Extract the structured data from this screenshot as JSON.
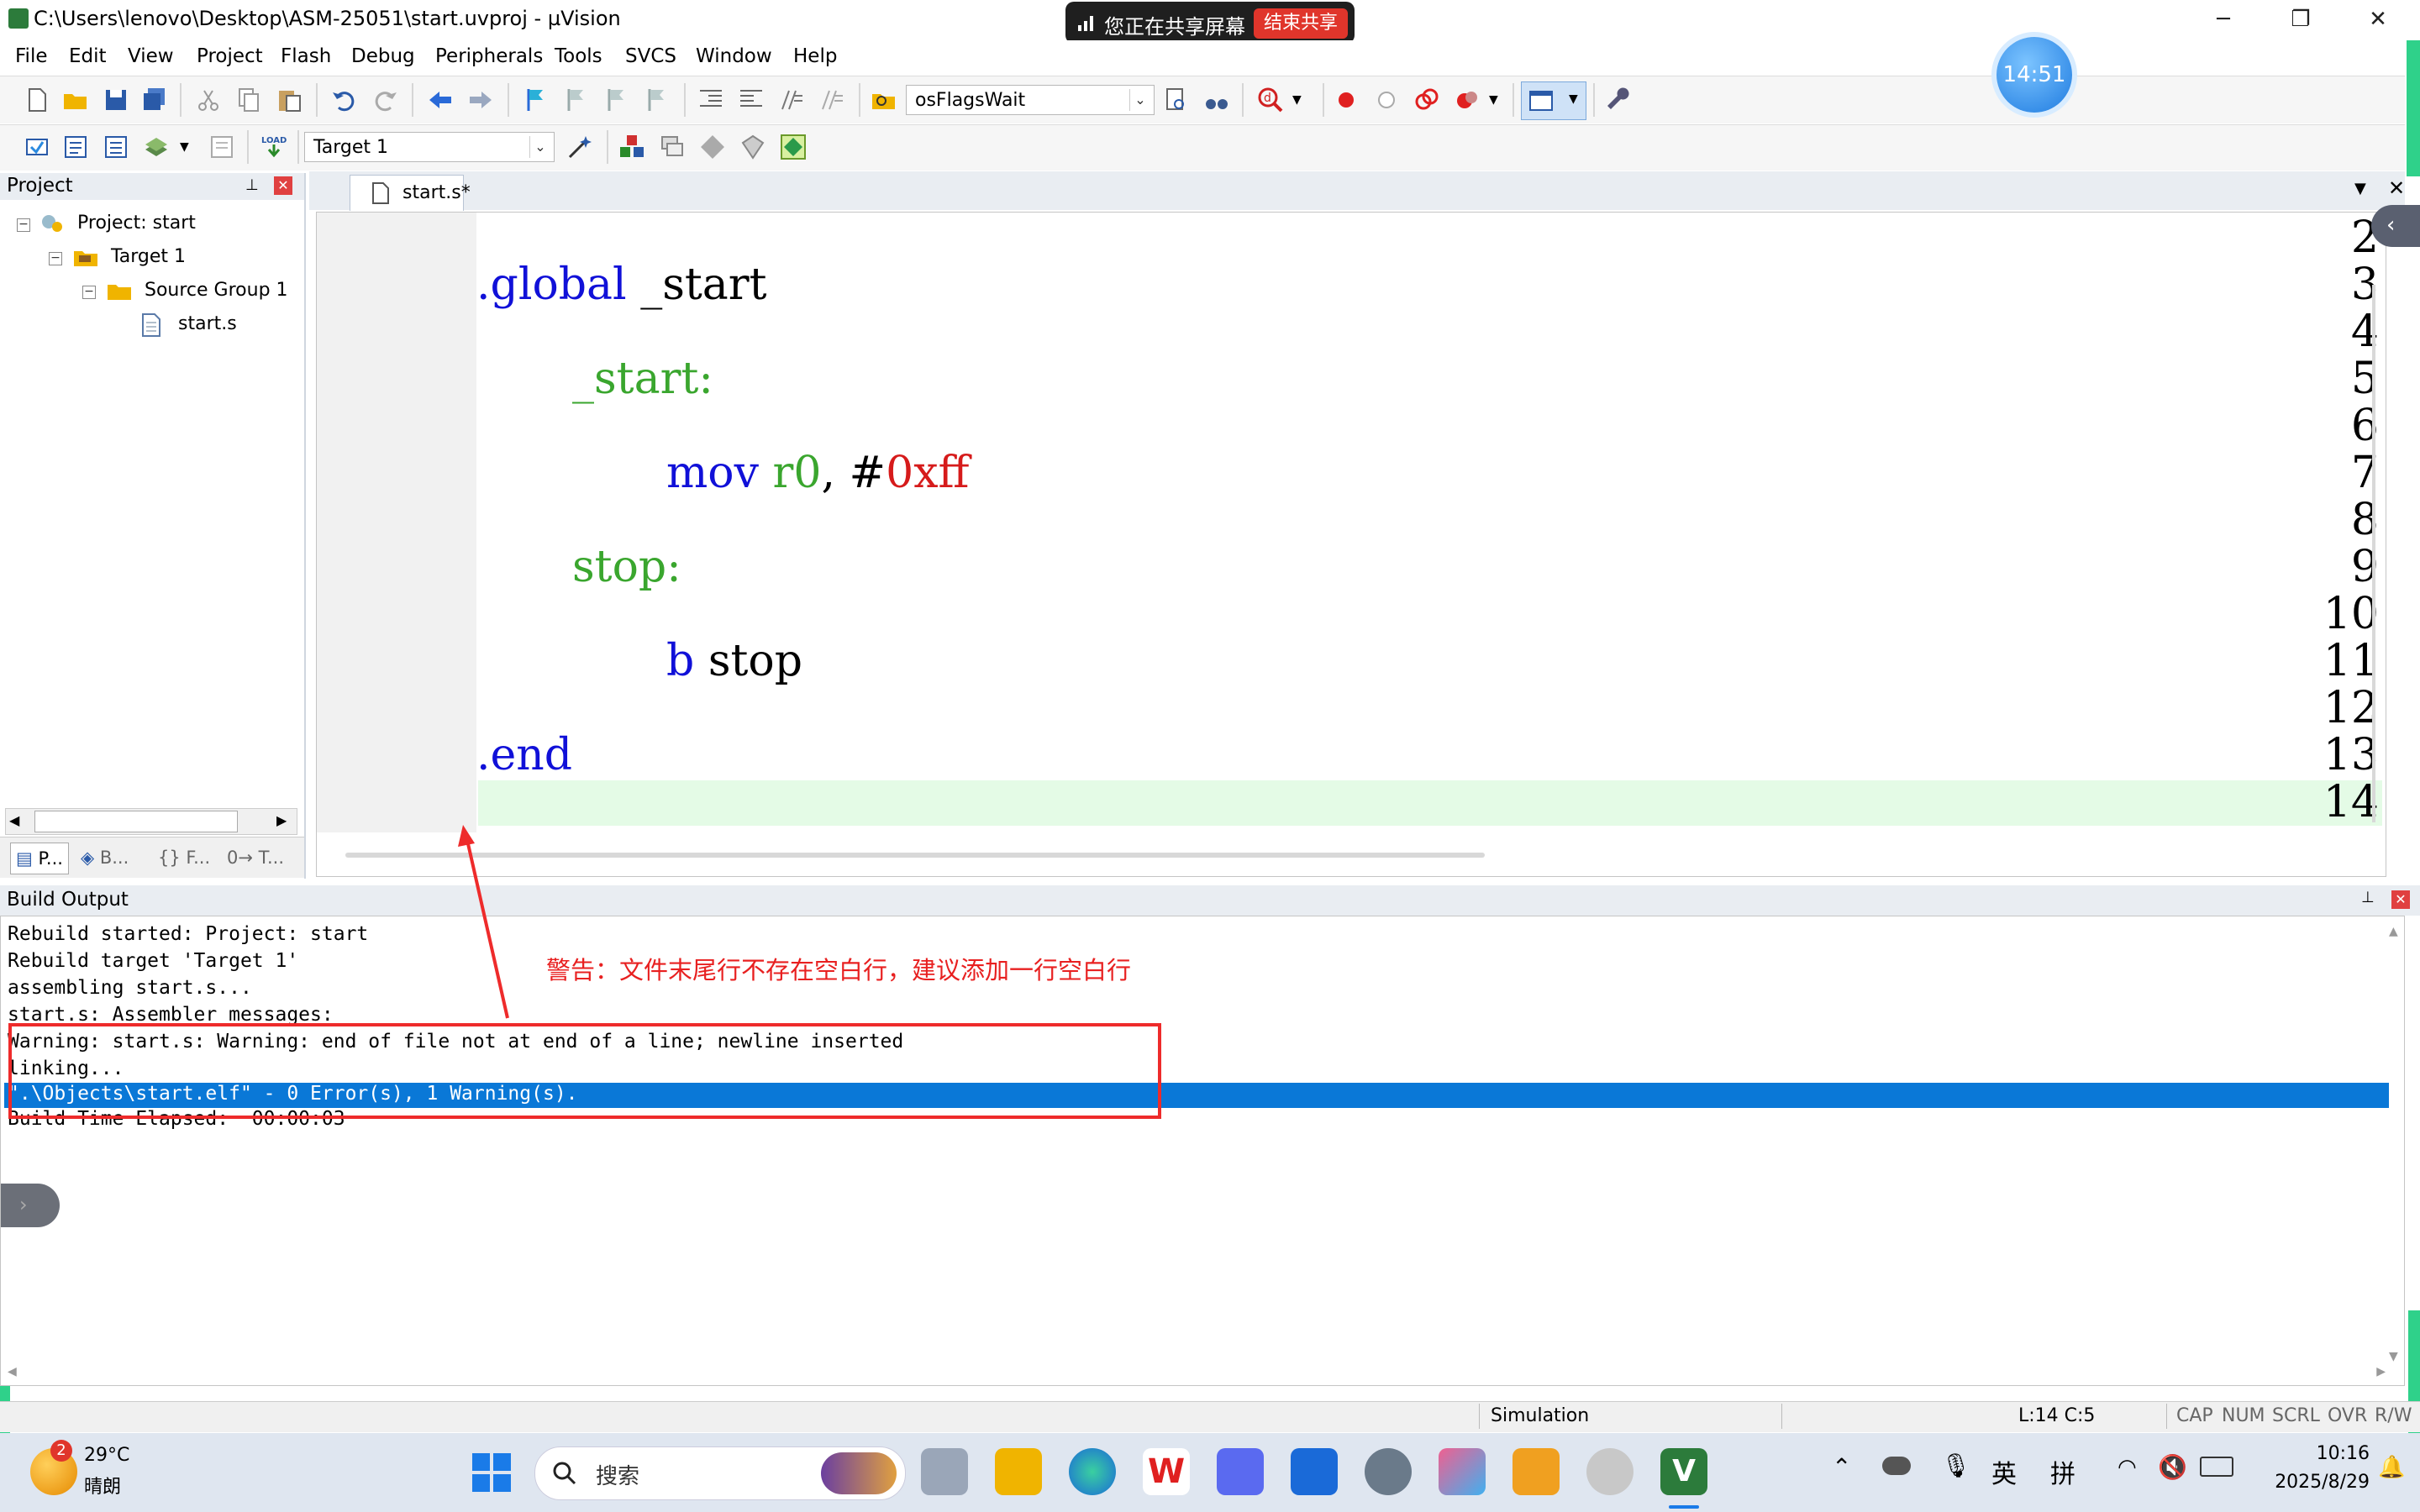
{
  "window": {
    "title": "C:\\Users\\lenovo\\Desktop\\ASM-25051\\start.uvproj - µVision",
    "min": "─",
    "restore": "❐",
    "close": "✕"
  },
  "share": {
    "label": "您正在共享屏幕",
    "stop": "结束共享"
  },
  "timer": "14:51",
  "menu": [
    "File",
    "Edit",
    "View",
    "Project",
    "Flash",
    "Debug",
    "Peripherals",
    "Tools",
    "SVCS",
    "Window",
    "Help"
  ],
  "toolbar": {
    "find_combo": "osFlagsWait",
    "target_combo": "Target 1"
  },
  "project_panel": {
    "title": "Project",
    "tree": {
      "project": "Project: start",
      "target": "Target 1",
      "group": "Source Group 1",
      "file": "start.s"
    },
    "tabs": [
      "P...",
      "B...",
      "{} F...",
      "0→ T..."
    ]
  },
  "editor": {
    "tab": "start.s*",
    "line_numbers": [
      "2",
      "3",
      "4",
      "5",
      "6",
      "7",
      "8",
      "9",
      "10",
      "11",
      "12",
      "13",
      "14"
    ],
    "code": {
      "l3_dot": ".",
      "l3_kw": "global",
      "l3_rest": " _start",
      "l5_label": "_start",
      "l5_colon": ":",
      "l7_kw": "mov",
      "l7_reg": "r0",
      "l7_mid": ", #",
      "l7_num": "0xff",
      "l9_label": "stop",
      "l9_colon": ":",
      "l11_kw": "b",
      "l11_rest": " stop",
      "l13_dot": ".",
      "l13_kw": "end"
    }
  },
  "build_output": {
    "title": "Build Output",
    "lines": [
      "Rebuild started: Project: start",
      "Rebuild target 'Target 1'",
      "assembling start.s...",
      "start.s: Assembler messages:",
      "Warning: start.s: Warning: end of file not at end of a line; newline inserted",
      "linking...",
      "\".\\Objects\\start.elf\" - 0 Error(s), 1 Warning(s).",
      "Build Time Elapsed:  00:00:03"
    ],
    "annotation": "警告：文件末尾行不存在空白行，建议添加一行空白行"
  },
  "status": {
    "mode": "Simulation",
    "position": "L:14 C:5",
    "flags": [
      "CAP",
      "NUM",
      "SCRL",
      "OVR",
      "R/W"
    ]
  },
  "taskbar": {
    "weather_badge": "2",
    "temp": "29°C",
    "weather": "晴朗",
    "search": "搜索",
    "ime_lang": "英",
    "ime_mode": "拼",
    "time": "10:16",
    "date": "2025/8/29"
  },
  "colors": {
    "keyword": "#1010d8",
    "label": "#3aa62e",
    "number": "#d61b1b",
    "selection": "#0a78d7",
    "annotation": "#e82020",
    "share_border": "#2fd18a"
  }
}
